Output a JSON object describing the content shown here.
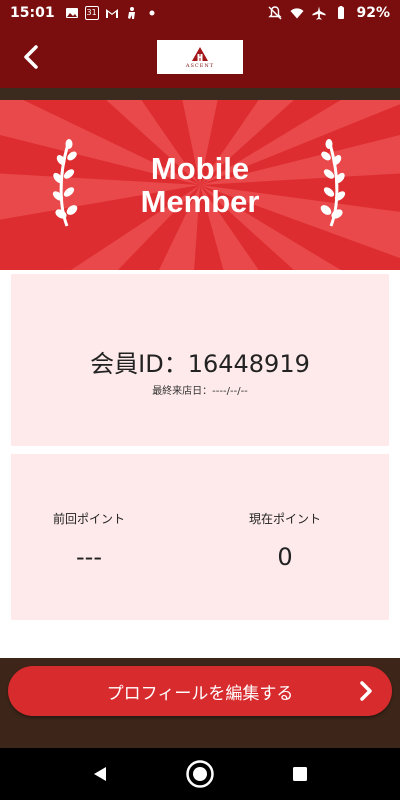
{
  "status_bar": {
    "time": "15:01",
    "calendar_day": "31",
    "battery": "92%"
  },
  "header": {
    "logo_text": "ASCENT"
  },
  "banner": {
    "title_line1": "Mobile",
    "title_line2": "Member"
  },
  "member_card": {
    "member_id": "会員ID：16448919",
    "last_visit": "最終来店日：----/--/--"
  },
  "points": {
    "previous_label": "前回ポイント",
    "previous_value": "---",
    "current_label": "現在ポイント",
    "current_value": "0"
  },
  "actions": {
    "edit_profile": "プロフィールを編集する"
  },
  "colors": {
    "brand_dark": "#7a0e0e",
    "banner_red": "#dd2d30",
    "card_pink": "#feeaea",
    "button_red": "#d82b2e"
  }
}
